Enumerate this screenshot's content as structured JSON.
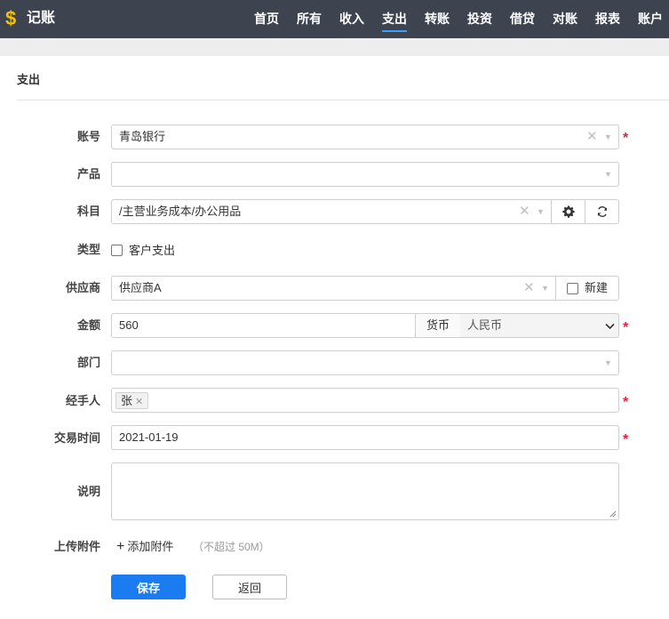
{
  "app": {
    "logo_glyph": "$",
    "brand": "记账",
    "logo_color": "#f5c000"
  },
  "nav": {
    "items": [
      {
        "label": "首页"
      },
      {
        "label": "所有"
      },
      {
        "label": "收入"
      },
      {
        "label": "支出",
        "active": true
      },
      {
        "label": "转账"
      },
      {
        "label": "投资"
      },
      {
        "label": "借贷"
      },
      {
        "label": "对账"
      },
      {
        "label": "报表"
      },
      {
        "label": "账户"
      }
    ],
    "active_underline_color": "#3aa0ff"
  },
  "panel": {
    "title": "支出"
  },
  "form": {
    "account": {
      "label": "账号",
      "value": "青岛银行",
      "required": true
    },
    "product": {
      "label": "产品",
      "value": ""
    },
    "subject": {
      "label": "科目",
      "value": "/主营业务成本/办公用品",
      "settings_icon": "gear-icon",
      "refresh_icon": "refresh-icon"
    },
    "type": {
      "label": "类型",
      "checkbox_label": "客户支出",
      "checked": false
    },
    "supplier": {
      "label": "供应商",
      "value": "供应商A",
      "new_label": "新建",
      "new_checked": false
    },
    "amount": {
      "label": "金额",
      "value": "560",
      "currency_label": "货币",
      "currency_value": "人民币",
      "required": true
    },
    "department": {
      "label": "部门",
      "value": ""
    },
    "handler": {
      "label": "经手人",
      "tags": [
        "张"
      ],
      "required": true
    },
    "trade_time": {
      "label": "交易时间",
      "value": "2021-01-19",
      "required": true
    },
    "description": {
      "label": "说明",
      "value": ""
    },
    "attachment": {
      "label": "上传附件",
      "add_label": "添加附件",
      "hint": "（不超过 50M）"
    },
    "required_mark": "*",
    "required_color": "#e0243e"
  },
  "actions": {
    "save_label": "保存",
    "back_label": "返回",
    "save_color": "#1a7cf0"
  }
}
